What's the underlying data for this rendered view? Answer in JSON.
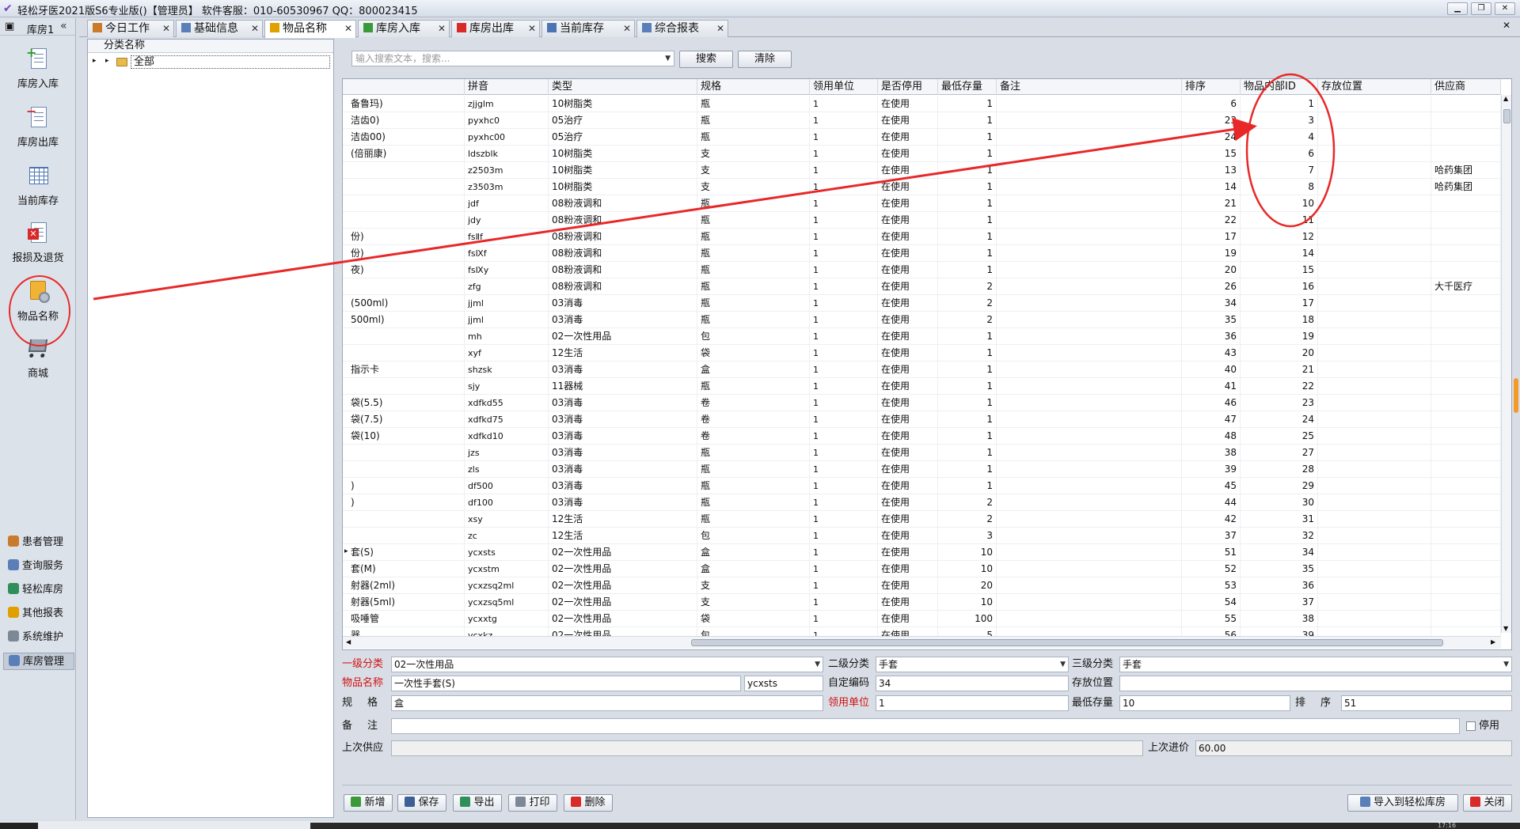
{
  "window": {
    "title": "轻松牙医2021版S6专业版()【管理员】   软件客服：010-60530967 QQ：800023415",
    "buttons": [
      "▁",
      "❐",
      "✕"
    ]
  },
  "left_nav": {
    "header": "库房1",
    "items": [
      {
        "label": "库房入库",
        "icon": "doc-plus-icon"
      },
      {
        "label": "库房出库",
        "icon": "doc-minus-icon"
      },
      {
        "label": "当前库存",
        "icon": "table-icon"
      },
      {
        "label": "报损及退货",
        "icon": "doc-error-icon"
      },
      {
        "label": "物品名称",
        "icon": "box-gear-icon"
      },
      {
        "label": "商城",
        "icon": "cart-icon"
      }
    ],
    "bottom_items": [
      {
        "label": "患者管理",
        "color": "#c97a2a"
      },
      {
        "label": "查询服务",
        "color": "#5a7fb8"
      },
      {
        "label": "轻松库房",
        "color": "#2f8f5a"
      },
      {
        "label": "其他报表",
        "color": "#e0a000"
      },
      {
        "label": "系统维护",
        "color": "#7d8896"
      },
      {
        "label": "库房管理",
        "color": "#5a7fb8"
      }
    ]
  },
  "tabs": [
    {
      "label": "今日工作",
      "color": "#c97a2a"
    },
    {
      "label": "基础信息",
      "color": "#5a7fb8"
    },
    {
      "label": "物品名称",
      "color": "#e0a000"
    },
    {
      "label": "库房入库",
      "color": "#3a9a3a"
    },
    {
      "label": "库房出库",
      "color": "#d92a2a"
    },
    {
      "label": "当前库存",
      "color": "#4c74b5"
    },
    {
      "label": "综合报表",
      "color": "#5a7fb8"
    }
  ],
  "tab_close": "✕",
  "tree": {
    "header": "分类名称",
    "root_label": "全部",
    "expand_glyph": "▸"
  },
  "search": {
    "placeholder": "输入搜索文本，搜索...",
    "search_button": "搜索",
    "clear_button": "清除"
  },
  "grid": {
    "columns": [
      "",
      "拼音",
      "类型",
      "规格",
      "领用单位",
      "是否停用",
      "最低存量",
      "备注",
      "排序",
      "物品内部ID",
      "存放位置",
      "供应商"
    ],
    "rows": [
      [
        "备鲁玛)",
        "zjjglm",
        "10树脂类",
        "瓶",
        "1",
        "在使用",
        "1",
        "",
        "6",
        "1",
        "",
        ""
      ],
      [
        "洁齿0)",
        "pyxhc0",
        "05治疗",
        "瓶",
        "1",
        "在使用",
        "1",
        "",
        "23",
        "3",
        "",
        ""
      ],
      [
        "洁齿00)",
        "pyxhc00",
        "05治疗",
        "瓶",
        "1",
        "在使用",
        "1",
        "",
        "24",
        "4",
        "",
        ""
      ],
      [
        "(倍丽康)",
        "ldszblk",
        "10树脂类",
        "支",
        "1",
        "在使用",
        "1",
        "",
        "15",
        "6",
        "",
        ""
      ],
      [
        "",
        "z2503m",
        "10树脂类",
        "支",
        "1",
        "在使用",
        "1",
        "",
        "13",
        "7",
        "",
        "哈药集团"
      ],
      [
        "",
        "z3503m",
        "10树脂类",
        "支",
        "1",
        "在使用",
        "1",
        "",
        "14",
        "8",
        "",
        "哈药集团"
      ],
      [
        "",
        "jdf",
        "08粉液调和",
        "瓶",
        "1",
        "在使用",
        "1",
        "",
        "21",
        "10",
        "",
        ""
      ],
      [
        "",
        "jdy",
        "08粉液调和",
        "瓶",
        "1",
        "在使用",
        "1",
        "",
        "22",
        "11",
        "",
        ""
      ],
      [
        "份)",
        "fsⅡf",
        "08粉液调和",
        "瓶",
        "1",
        "在使用",
        "1",
        "",
        "17",
        "12",
        "",
        ""
      ],
      [
        "份)",
        "fsⅨf",
        "08粉液调和",
        "瓶",
        "1",
        "在使用",
        "1",
        "",
        "19",
        "14",
        "",
        ""
      ],
      [
        "夜)",
        "fsⅨy",
        "08粉液调和",
        "瓶",
        "1",
        "在使用",
        "1",
        "",
        "20",
        "15",
        "",
        ""
      ],
      [
        "",
        "zfg",
        "08粉液调和",
        "瓶",
        "1",
        "在使用",
        "2",
        "",
        "26",
        "16",
        "",
        "大千医疗"
      ],
      [
        "(500ml)",
        "jjml",
        "03消毒",
        "瓶",
        "1",
        "在使用",
        "2",
        "",
        "34",
        "17",
        "",
        ""
      ],
      [
        "500ml)",
        "jjml",
        "03消毒",
        "瓶",
        "1",
        "在使用",
        "2",
        "",
        "35",
        "18",
        "",
        ""
      ],
      [
        "",
        "mh",
        "02一次性用品",
        "包",
        "1",
        "在使用",
        "1",
        "",
        "36",
        "19",
        "",
        ""
      ],
      [
        "",
        "xyf",
        "12生活",
        "袋",
        "1",
        "在使用",
        "1",
        "",
        "43",
        "20",
        "",
        ""
      ],
      [
        "指示卡",
        "shzsk",
        "03消毒",
        "盒",
        "1",
        "在使用",
        "1",
        "",
        "40",
        "21",
        "",
        ""
      ],
      [
        "",
        "sjy",
        "11器械",
        "瓶",
        "1",
        "在使用",
        "1",
        "",
        "41",
        "22",
        "",
        ""
      ],
      [
        "袋(5.5)",
        "xdfkd55",
        "03消毒",
        "卷",
        "1",
        "在使用",
        "1",
        "",
        "46",
        "23",
        "",
        ""
      ],
      [
        "袋(7.5)",
        "xdfkd75",
        "03消毒",
        "卷",
        "1",
        "在使用",
        "1",
        "",
        "47",
        "24",
        "",
        ""
      ],
      [
        "袋(10)",
        "xdfkd10",
        "03消毒",
        "卷",
        "1",
        "在使用",
        "1",
        "",
        "48",
        "25",
        "",
        ""
      ],
      [
        "",
        "jzs",
        "03消毒",
        "瓶",
        "1",
        "在使用",
        "1",
        "",
        "38",
        "27",
        "",
        ""
      ],
      [
        "",
        "zls",
        "03消毒",
        "瓶",
        "1",
        "在使用",
        "1",
        "",
        "39",
        "28",
        "",
        ""
      ],
      [
        ")",
        "df500",
        "03消毒",
        "瓶",
        "1",
        "在使用",
        "1",
        "",
        "45",
        "29",
        "",
        ""
      ],
      [
        ")",
        "df100",
        "03消毒",
        "瓶",
        "1",
        "在使用",
        "2",
        "",
        "44",
        "30",
        "",
        ""
      ],
      [
        "",
        "xsy",
        "12生活",
        "瓶",
        "1",
        "在使用",
        "2",
        "",
        "42",
        "31",
        "",
        ""
      ],
      [
        "",
        "zc",
        "12生活",
        "包",
        "1",
        "在使用",
        "3",
        "",
        "37",
        "32",
        "",
        ""
      ],
      [
        "套(S)",
        "ycxsts",
        "02一次性用品",
        "盒",
        "1",
        "在使用",
        "10",
        "",
        "51",
        "34",
        "",
        ""
      ],
      [
        "套(M)",
        "ycxstm",
        "02一次性用品",
        "盒",
        "1",
        "在使用",
        "10",
        "",
        "52",
        "35",
        "",
        ""
      ],
      [
        "射器(2ml)",
        "ycxzsq2ml",
        "02一次性用品",
        "支",
        "1",
        "在使用",
        "20",
        "",
        "53",
        "36",
        "",
        ""
      ],
      [
        "射器(5ml)",
        "ycxzsq5ml",
        "02一次性用品",
        "支",
        "1",
        "在使用",
        "10",
        "",
        "54",
        "37",
        "",
        ""
      ],
      [
        "吸唾管",
        "ycxxtg",
        "02一次性用品",
        "袋",
        "1",
        "在使用",
        "100",
        "",
        "55",
        "38",
        "",
        ""
      ],
      [
        "器",
        "ycxkz",
        "02一次性用品",
        "包",
        "1",
        "在使用",
        "5",
        "",
        "56",
        "39",
        "",
        ""
      ]
    ],
    "current_row_marker": "▸",
    "current_row": 27
  },
  "form": {
    "level1_label": "一级分类",
    "level1_value": "02一次性用品",
    "level2_label": "二级分类",
    "level2_value": "手套",
    "level3_label": "三级分类",
    "level3_value": "手套",
    "name_label": "物品名称",
    "name_value": "一次性手套(S)",
    "pinyin_value": "ycxsts",
    "code_label": "自定编码",
    "code_value": "34",
    "location_label": "存放位置",
    "location_value": "",
    "spec_label": "规　格",
    "spec_value": "盒",
    "unit_label": "领用单位",
    "unit_value": "1",
    "minstock_label": "最低存量",
    "minstock_value": "10",
    "sort_label": "排　序",
    "sort_value": "51",
    "note_label": "备　注",
    "note_value": "",
    "disabled_label": "停用",
    "last_supplier_label": "上次供应",
    "last_supplier_value": "",
    "last_price_label": "上次进价",
    "last_price_value": "60.00"
  },
  "toolbar": {
    "add": "新增",
    "save": "保存",
    "export": "导出",
    "print": "打印",
    "delete": "删除",
    "import": "导入到轻松库房",
    "close": "关闭"
  },
  "status": {
    "time": "17:16"
  },
  "colors": {
    "annotation": "#e82828",
    "required_label": "#d01010"
  }
}
